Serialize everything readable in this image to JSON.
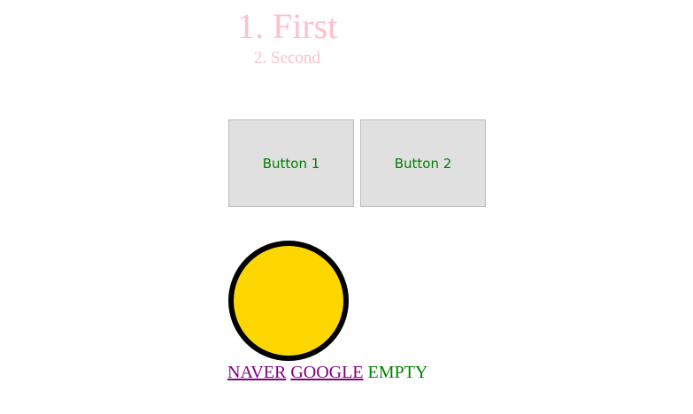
{
  "headings": {
    "first": "1. First",
    "second": "2. Second"
  },
  "buttons": [
    {
      "label": "Button 1"
    },
    {
      "label": "Button 2"
    }
  ],
  "links": [
    {
      "label": "NAVER"
    },
    {
      "label": "GOOGLE"
    }
  ],
  "empty_label": "EMPTY",
  "colors": {
    "heading": "#ffc0cb",
    "button_text": "#008000",
    "button_bg": "#e0e0e0",
    "circle_fill": "#ffd700",
    "circle_border": "#000000",
    "visited_link": "#800080",
    "empty_text": "#008000"
  }
}
